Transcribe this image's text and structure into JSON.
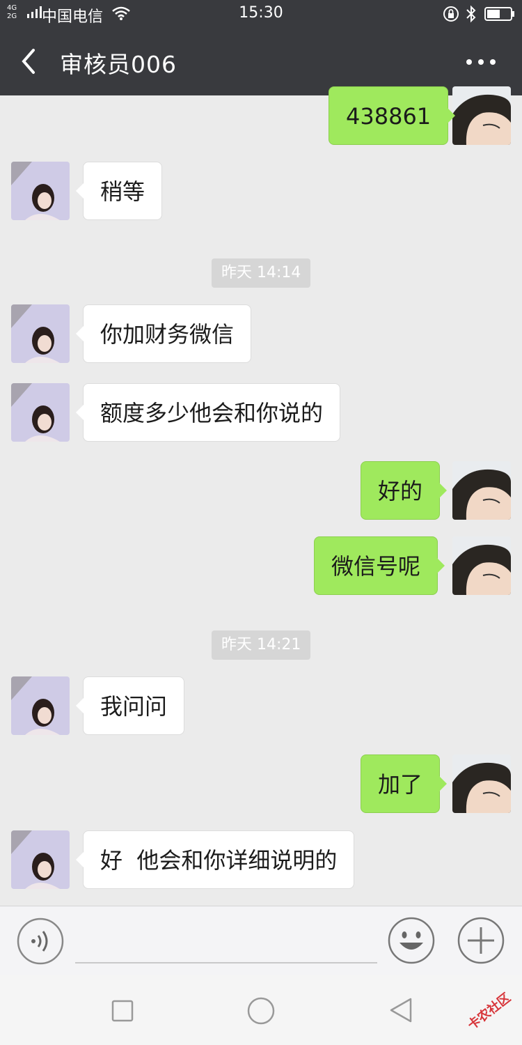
{
  "status_bar": {
    "network_type": "4G 2G",
    "carrier": "中国电信",
    "time": "15:30"
  },
  "header": {
    "back_icon": "chevron-left-icon",
    "title": "审核员006",
    "more_icon": "more-dots-icon"
  },
  "messages": [
    {
      "side": "out",
      "text": "438861"
    },
    {
      "side": "in",
      "text": "稍等"
    },
    {
      "type": "timestamp",
      "text": "昨天 14:14"
    },
    {
      "side": "in",
      "text": "你加财务微信"
    },
    {
      "side": "in",
      "text": "额度多少他会和你说的"
    },
    {
      "side": "out",
      "text": "好的"
    },
    {
      "side": "out",
      "text": "微信号呢"
    },
    {
      "type": "timestamp",
      "text": "昨天 14:21"
    },
    {
      "side": "in",
      "text": "我问问"
    },
    {
      "side": "out",
      "text": "加了"
    },
    {
      "side": "in",
      "text": "好  他会和你详细说明的"
    }
  ],
  "input_bar": {
    "voice_icon": "voice-input-icon",
    "text_value": "",
    "emoji_icon": "emoji-icon",
    "plus_icon": "add-more-icon"
  },
  "nav_bar": {
    "recent_icon": "recent-apps-icon",
    "home_icon": "home-icon",
    "back_icon": "back-triangle-icon"
  },
  "watermark": {
    "text": "卡农社区"
  },
  "colors": {
    "header_bg": "#393a3e",
    "chat_bg": "#ebebeb",
    "outgoing_bubble": "#9fe95d",
    "incoming_bubble": "#ffffff",
    "timestamp_bg": "#d6d6d6"
  }
}
